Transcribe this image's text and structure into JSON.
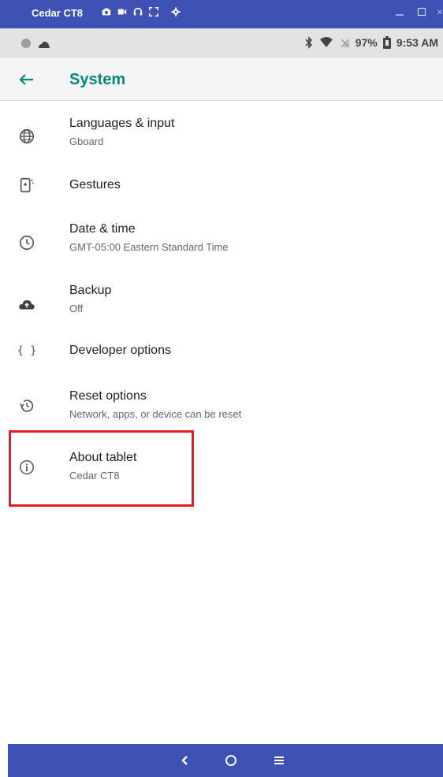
{
  "window": {
    "title": "Cedar CT8",
    "tools": [
      "camera-icon",
      "video-icon",
      "headset-icon",
      "fullscreen-icon",
      "gear-icon"
    ],
    "controls": [
      "minimize-icon",
      "maximize-icon",
      "close-icon"
    ]
  },
  "status": {
    "left_icons": [
      "circle-icon",
      "cloud-icon"
    ],
    "battery": "97%",
    "time": "9:53 AM"
  },
  "app_bar": {
    "title": "System"
  },
  "items": [
    {
      "title": "Languages & input",
      "subtitle": "Gboard",
      "icon": "globe-icon"
    },
    {
      "title": "Gestures",
      "subtitle": "",
      "icon": "gestures-icon"
    },
    {
      "title": "Date & time",
      "subtitle": "GMT-05:00 Eastern Standard Time",
      "icon": "clock-icon"
    },
    {
      "title": "Backup",
      "subtitle": "Off",
      "icon": "cloud-upload-icon"
    },
    {
      "title": "Developer options",
      "subtitle": "",
      "icon": "braces-icon"
    },
    {
      "title": "Reset options",
      "subtitle": "Network, apps, or device can be reset",
      "icon": "restore-icon"
    },
    {
      "title": "About tablet",
      "subtitle": "Cedar CT8",
      "icon": "info-icon"
    }
  ],
  "colors": {
    "window_bar": "#3f51b5",
    "status_bar": "#e3e3e3",
    "accent": "#00897b",
    "highlight": "#e51c23"
  }
}
